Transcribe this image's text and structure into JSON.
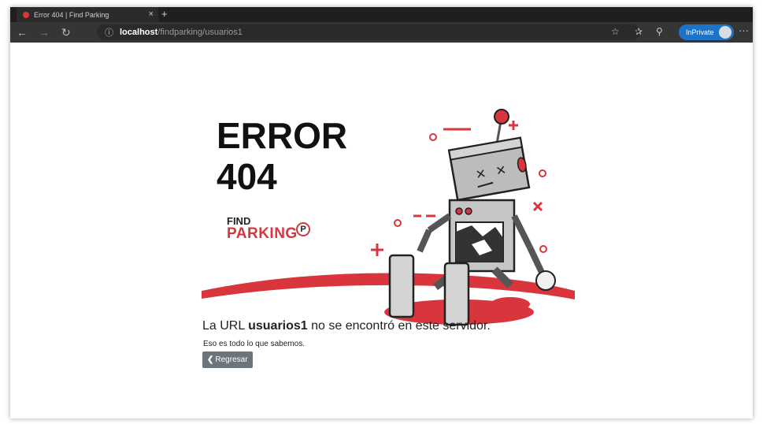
{
  "browser": {
    "tab_title": "Error 404 | Find Parking",
    "url_host": "localhost",
    "url_path": "/findparking/usuarios1",
    "inprivate_label": "InPrivate",
    "icons": [
      "back-icon",
      "forward-icon",
      "refresh-icon",
      "info-icon",
      "favorite-star-icon",
      "favorites-list-icon",
      "collections-icon",
      "more-icon"
    ]
  },
  "page": {
    "error_line1": "ERROR",
    "error_line2": "404",
    "logo_find": "FIND",
    "logo_parking": "PARKING",
    "logo_badge": "P",
    "message_prefix": "La URL ",
    "message_url": "usuarios1",
    "message_suffix": " no se encontró en este servidor.",
    "submessage": "Eso es todo lo que sabemos.",
    "back_label": "Regresar"
  },
  "colors": {
    "accent": "#d9353c",
    "button": "#6c757d",
    "inprivate": "#1e72c8",
    "chrome_dark": "#1f1f1f"
  }
}
